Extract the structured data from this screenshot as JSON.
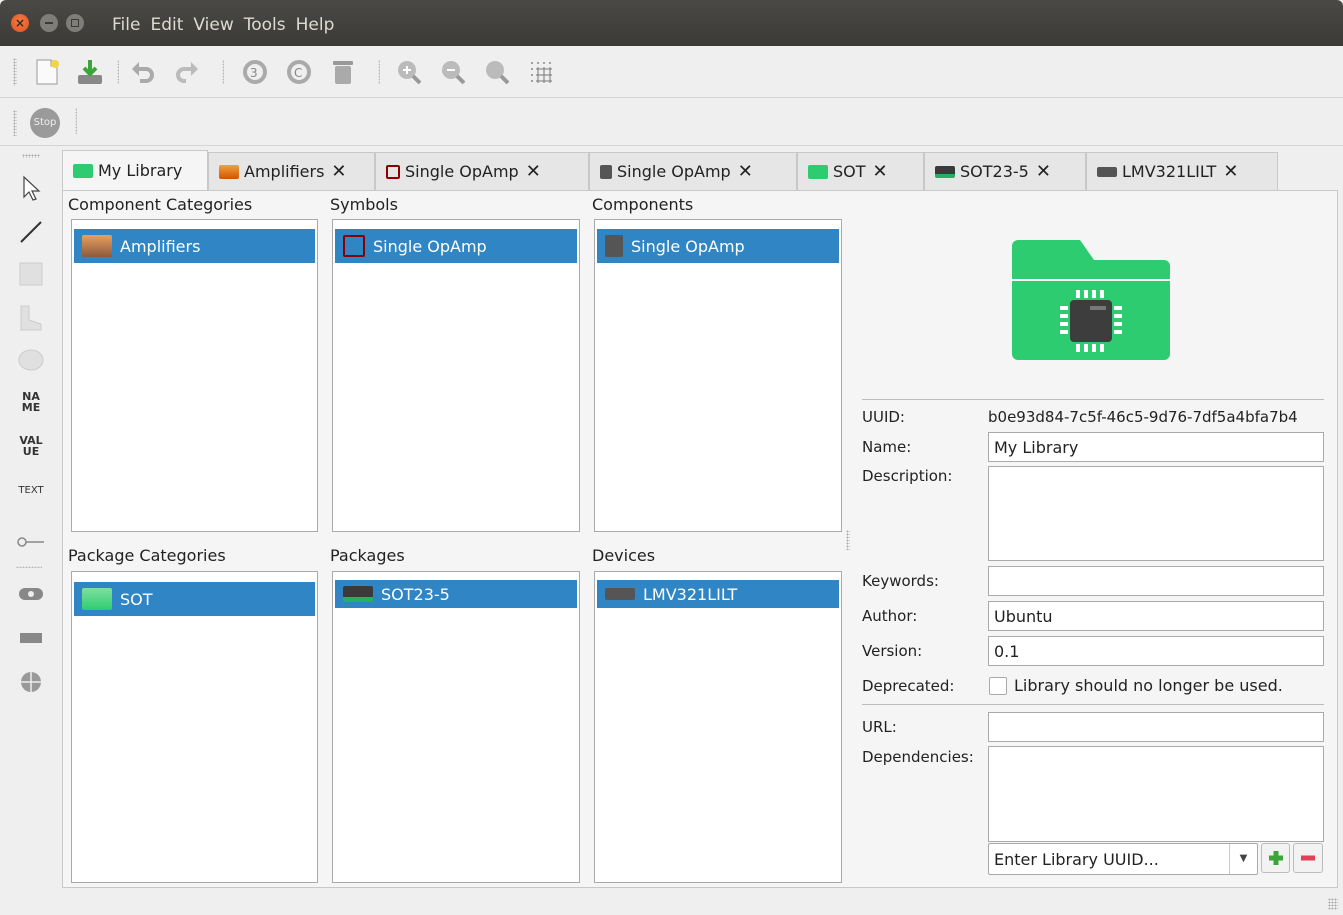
{
  "menu": {
    "file": "File",
    "edit": "Edit",
    "view": "View",
    "tools": "Tools",
    "help": "Help"
  },
  "toolbar2": {
    "stop_label": "Stop"
  },
  "left_tools": {
    "name": "NA\nME",
    "value": "VAL\nUE",
    "text": "TEXT"
  },
  "tabs": [
    {
      "label": "My Library",
      "color": "#2ecc71",
      "closable": false
    },
    {
      "label": "Amplifiers",
      "color": "#e67e22",
      "closable": true
    },
    {
      "label": "Single OpAmp",
      "color": "#8b0000",
      "closable": true
    },
    {
      "label": "Single OpAmp",
      "color": "#555555",
      "closable": true
    },
    {
      "label": "SOT",
      "color": "#2ecc71",
      "closable": true
    },
    {
      "label": "SOT23-5",
      "color": "#27ae60",
      "closable": true
    },
    {
      "label": "LMV321LILT",
      "color": "#555555",
      "closable": true
    }
  ],
  "sections": {
    "component_categories": "Component Categories",
    "symbols": "Symbols",
    "components": "Components",
    "package_categories": "Package Categories",
    "packages": "Packages",
    "devices": "Devices"
  },
  "lists": {
    "component_categories": "Amplifiers",
    "symbols": "Single OpAmp",
    "components": "Single OpAmp",
    "package_categories": "SOT",
    "packages": "SOT23-5",
    "devices": "LMV321LILT"
  },
  "props": {
    "uuid_label": "UUID:",
    "uuid_value": "b0e93d84-7c5f-46c5-9d76-7df5a4bfa7b4",
    "name_label": "Name:",
    "name_value": "My Library",
    "description_label": "Description:",
    "description_value": "",
    "keywords_label": "Keywords:",
    "keywords_value": "",
    "author_label": "Author:",
    "author_value": "Ubuntu",
    "version_label": "Version:",
    "version_value": "0.1",
    "deprecated_label": "Deprecated:",
    "deprecated_text": "Library should no longer be used.",
    "deprecated_checked": false,
    "url_label": "URL:",
    "url_value": "",
    "dependencies_label": "Dependencies:",
    "dependency_placeholder": "Enter Library UUID..."
  },
  "colors": {
    "selection": "#3085c4",
    "library_icon": "#2ecc71"
  }
}
